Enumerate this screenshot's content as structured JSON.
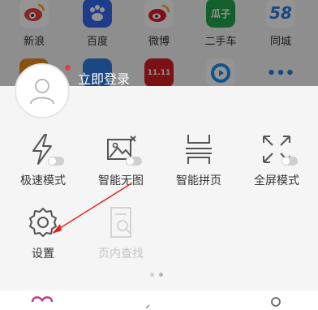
{
  "home_apps_row1": [
    {
      "label": "新浪",
      "icon": "sina-icon",
      "color": "#e8403d",
      "glyph": "◉"
    },
    {
      "label": "百度",
      "icon": "baidu-icon",
      "color": "#3268f0",
      "glyph": "✋"
    },
    {
      "label": "微博",
      "icon": "weibo-icon",
      "color": "#f04a3a",
      "glyph": "◉"
    },
    {
      "label": "二手车",
      "icon": "guazi-icon",
      "color": "#23a64d",
      "glyph": "瓜子"
    },
    {
      "label": "同城",
      "icon": "58-icon",
      "color": "#ffffff",
      "glyph": "58"
    }
  ],
  "home_apps_row2": [
    {
      "icon": "app-orange-icon",
      "color": "#f28a1e",
      "glyph": ""
    },
    {
      "icon": "app-blue-icon",
      "color": "#2f7de0",
      "glyph": ""
    },
    {
      "icon": "tmall-icon",
      "color": "#d41e24",
      "glyph": "11.11"
    },
    {
      "icon": "video-play-icon",
      "color": "#ffffff",
      "glyph": "▶"
    },
    {
      "icon": "more-icon",
      "color": "#ffffff",
      "glyph": "•••"
    }
  ],
  "user": {
    "login_label": "立即登录"
  },
  "menu": {
    "fast_mode": "极速模式",
    "no_image": "智能无图",
    "smart_page": "智能拼页",
    "fullscreen": "全屏模式",
    "settings": "设置",
    "find_in_page": "页内查找"
  }
}
